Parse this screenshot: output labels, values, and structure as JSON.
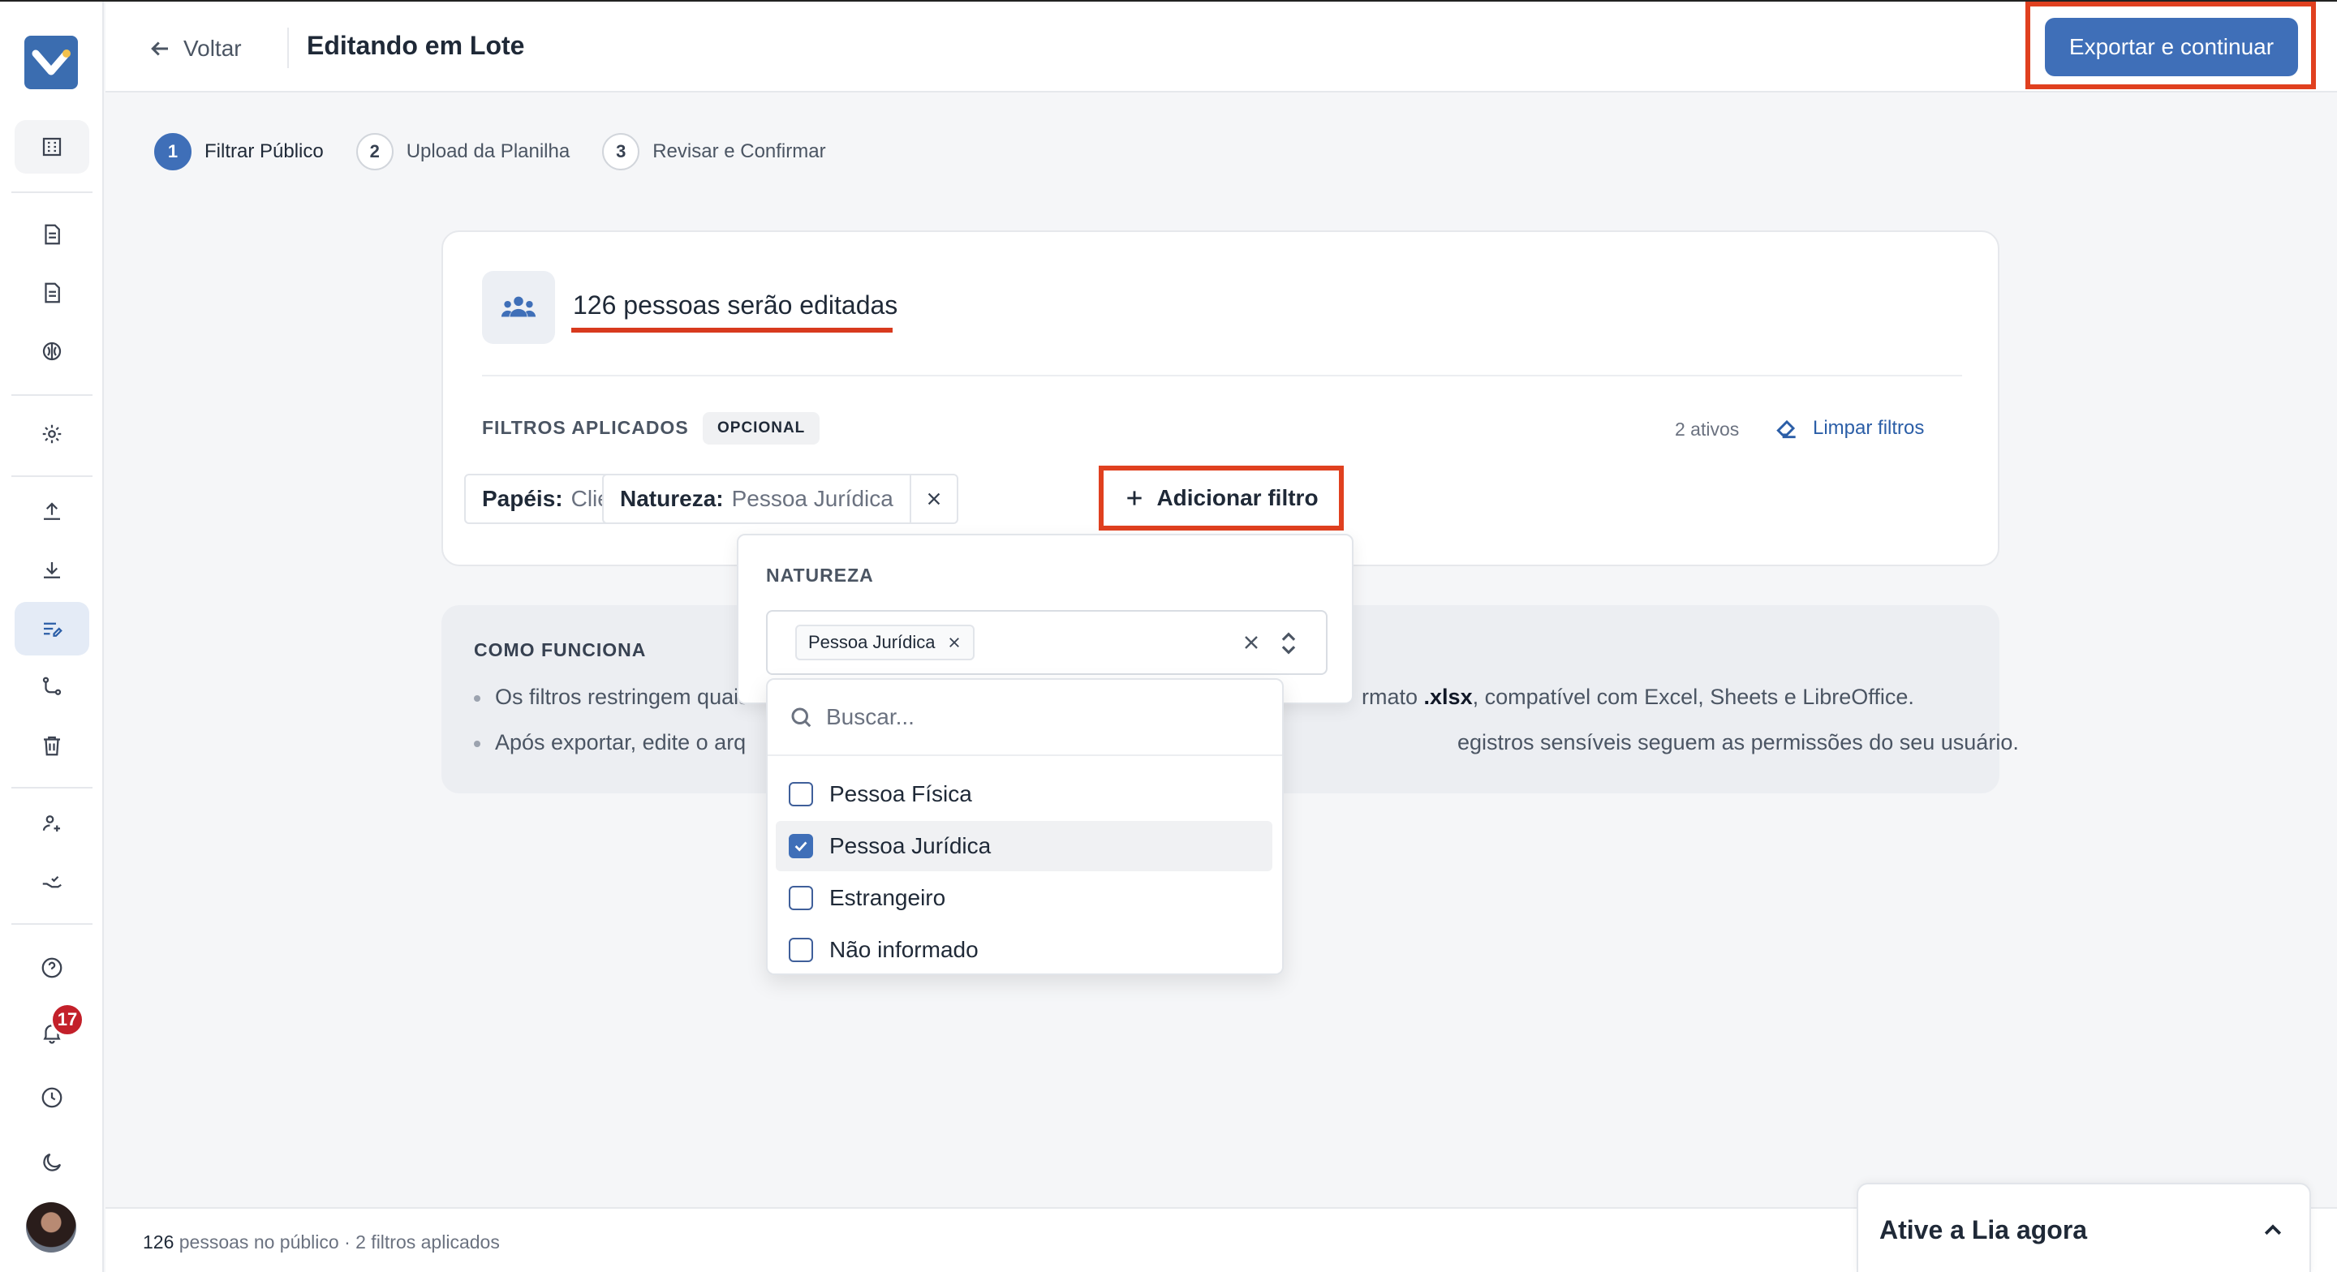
{
  "header": {
    "back_label": "Voltar",
    "title": "Editando em Lote",
    "export_label": "Exportar e continuar"
  },
  "steps": [
    {
      "num": "1",
      "label": "Filtrar Público",
      "active": true
    },
    {
      "num": "2",
      "label": "Upload da Planilha",
      "active": false
    },
    {
      "num": "3",
      "label": "Revisar e Confirmar",
      "active": false
    }
  ],
  "card": {
    "count_title": "126 pessoas serão editadas",
    "filters_label": "FILTROS APLICADOS",
    "optional_badge": "OPCIONAL",
    "active_count": "2 ativos",
    "clear_label": "Limpar filtros",
    "chips": [
      {
        "key": "Papéis:",
        "value": "Cliente"
      },
      {
        "key": "Natureza:",
        "value": "Pessoa Jurídica"
      }
    ],
    "add_filter_label": "Adicionar filtro"
  },
  "how": {
    "title": "COMO FUNCIONA",
    "line1_a": "Os filtros restringem quais",
    "line1_b": "rmato ",
    "line1_bold": ".xlsx",
    "line1_c": ", compatível com Excel, Sheets e LibreOffice.",
    "line2_a": "Após exportar, edite o arq",
    "line2_b": "egistros sensíveis seguem as permissões do seu usuário."
  },
  "popover": {
    "title": "NATUREZA",
    "selected_tag": "Pessoa Jurídica",
    "search_placeholder": "Buscar...",
    "options": [
      {
        "label": "Pessoa Física",
        "checked": false
      },
      {
        "label": "Pessoa Jurídica",
        "checked": true
      },
      {
        "label": "Estrangeiro",
        "checked": false
      },
      {
        "label": "Não informado",
        "checked": false
      }
    ]
  },
  "sidebar": {
    "notifications_count": "17"
  },
  "footer": {
    "count": "126",
    "text": " pessoas no público · 2 filtros aplicados"
  },
  "lia": {
    "title": "Ative a Lia agora"
  },
  "colors": {
    "accent": "#3f6fb8",
    "highlight": "#e0401f",
    "badge": "#c3202a"
  }
}
